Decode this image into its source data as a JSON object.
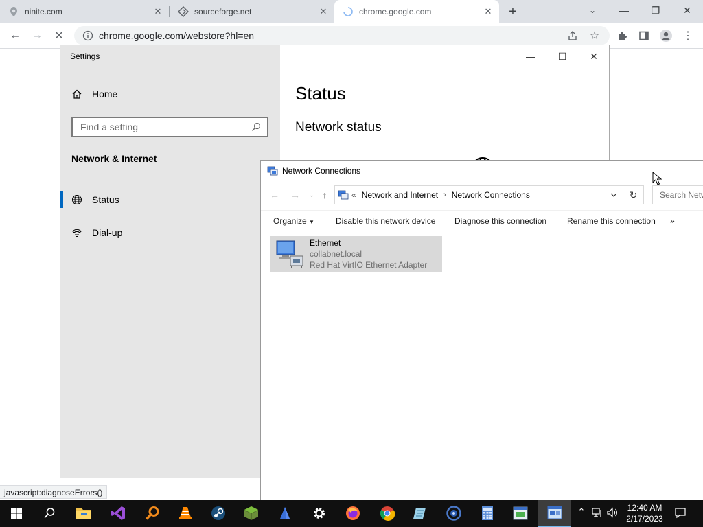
{
  "browser": {
    "tabs": [
      {
        "title": "ninite.com",
        "active": false
      },
      {
        "title": "sourceforge.net",
        "active": false
      },
      {
        "title": "chrome.google.com",
        "active": true
      }
    ],
    "url": "chrome.google.com/webstore?hl=en",
    "status_hint": "javascript:diagnoseErrors()"
  },
  "settings": {
    "window_title": "Settings",
    "home_label": "Home",
    "search_placeholder": "Find a setting",
    "section_title": "Network & Internet",
    "nav": [
      {
        "label": "Status",
        "selected": true
      },
      {
        "label": "Dial-up",
        "selected": false
      }
    ],
    "main_title": "Status",
    "main_subtitle": "Network status"
  },
  "network_connections": {
    "window_title": "Network Connections",
    "breadcrumb": [
      "Network and Internet",
      "Network Connections"
    ],
    "breadcrumb_prefix": "«",
    "search_placeholder": "Search Network Connections",
    "commands": {
      "organize": "Organize",
      "disable": "Disable this network device",
      "diagnose": "Diagnose this connection",
      "rename": "Rename this connection",
      "more": "»"
    },
    "items": [
      {
        "name": "Ethernet",
        "network": "collabnet.local",
        "adapter": "Red Hat VirtIO Ethernet Adapter"
      }
    ]
  },
  "taskbar": {
    "time": "12:40 AM",
    "date": "2/17/2023"
  },
  "colors": {
    "accent": "#0067c0",
    "taskbar_bg": "#101010",
    "selection_gray": "#d9d9d9"
  }
}
